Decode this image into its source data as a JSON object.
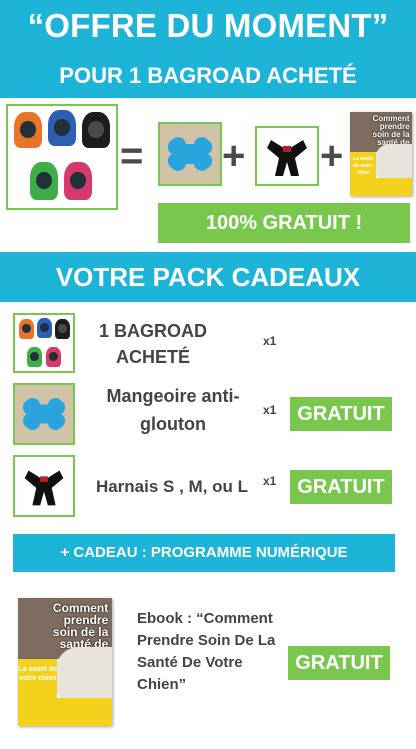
{
  "header": {
    "title": "“OFFRE DU MOMENT”",
    "subtitle": "POUR 1 BAGROAD ACHETÉ"
  },
  "offer": {
    "operators": [
      "=",
      "+",
      "+"
    ],
    "free_banner": "100% GRATUIT !"
  },
  "pack": {
    "title": "VOTRE PACK CADEAUX",
    "items": [
      {
        "label": "1  BAGROAD ACHETÉ",
        "qty": "x1",
        "badge": ""
      },
      {
        "label": "Mangeoire anti-glouton",
        "qty": "x1",
        "badge": "GRATUIT"
      },
      {
        "label": "Harnais S , M, ou L",
        "qty": "x1",
        "badge": "GRATUIT"
      }
    ]
  },
  "bonus": {
    "banner": "+ CADEAU : PROGRAMME NUMÉRIQUE",
    "ebook_label": "Ebook : “Comment Prendre Soin De La Santé De Votre Chien”",
    "badge": "GRATUIT"
  },
  "cover": {
    "title": "Comment prendre soin de la santé de votre chien",
    "side": "La santé de votre chien"
  },
  "colors": {
    "banner_blue": "#1eb4d8",
    "free_green": "#79c84d",
    "frame_green": "#78c850",
    "text_dark": "#444444"
  },
  "bag_colors": [
    "#e8742a",
    "#2d5fb5",
    "#1d1d1d",
    "#3fae49",
    "#d63a6c"
  ]
}
